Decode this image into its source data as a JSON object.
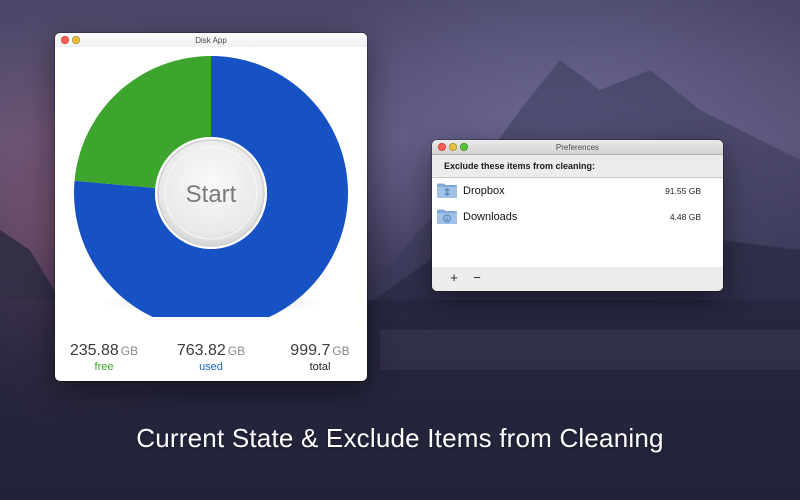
{
  "disk_app": {
    "title": "Disk App",
    "start_label": "Start",
    "usage": {
      "free_fraction": 0.2358,
      "used_fraction": 0.7642
    },
    "stats": {
      "free": {
        "value": "235.88",
        "unit": "GB",
        "label": "free",
        "color": "#3aa22b"
      },
      "used": {
        "value": "763.82",
        "unit": "GB",
        "label": "used",
        "color": "#1b67c8"
      },
      "total": {
        "value": "999.7",
        "unit": "GB",
        "label": "total",
        "color": "#222222"
      }
    },
    "colors": {
      "free": "#3da42d",
      "used": "#1652c4"
    }
  },
  "preferences": {
    "title": "Preferences",
    "heading": "Exclude these items from cleaning:",
    "items": [
      {
        "name": "Dropbox",
        "size": "91.55 GB",
        "icon": "dropbox-folder-icon"
      },
      {
        "name": "Downloads",
        "size": "4.48 GB",
        "icon": "downloads-folder-icon"
      }
    ],
    "add_label": "+",
    "remove_label": "−"
  },
  "caption": "Current State & Exclude Items from Cleaning"
}
